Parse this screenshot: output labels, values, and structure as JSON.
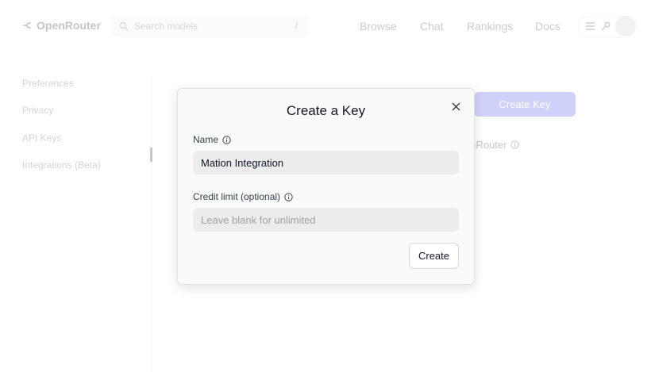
{
  "header": {
    "logo_text": "OpenRouter",
    "search_placeholder": "Search models",
    "search_shortcut": "/",
    "nav": [
      "Browse",
      "Chat",
      "Rankings",
      "Docs"
    ]
  },
  "sidebar": {
    "items": [
      {
        "label": "Preferences"
      },
      {
        "label": "Privacy"
      },
      {
        "label": "API Keys"
      },
      {
        "label": "Integrations (Beta)"
      }
    ]
  },
  "background": {
    "create_key_button": "Create Key",
    "partial_text": "enRouter"
  },
  "modal": {
    "title": "Create a Key",
    "name_label": "Name",
    "name_value": "Mation Integration",
    "credit_label": "Credit limit (optional)",
    "credit_placeholder": "Leave blank for unlimited",
    "create_label": "Create"
  },
  "colors": {
    "accent": "#6366f1",
    "field_bg": "#ececee",
    "modal_bg": "#fafafa"
  }
}
